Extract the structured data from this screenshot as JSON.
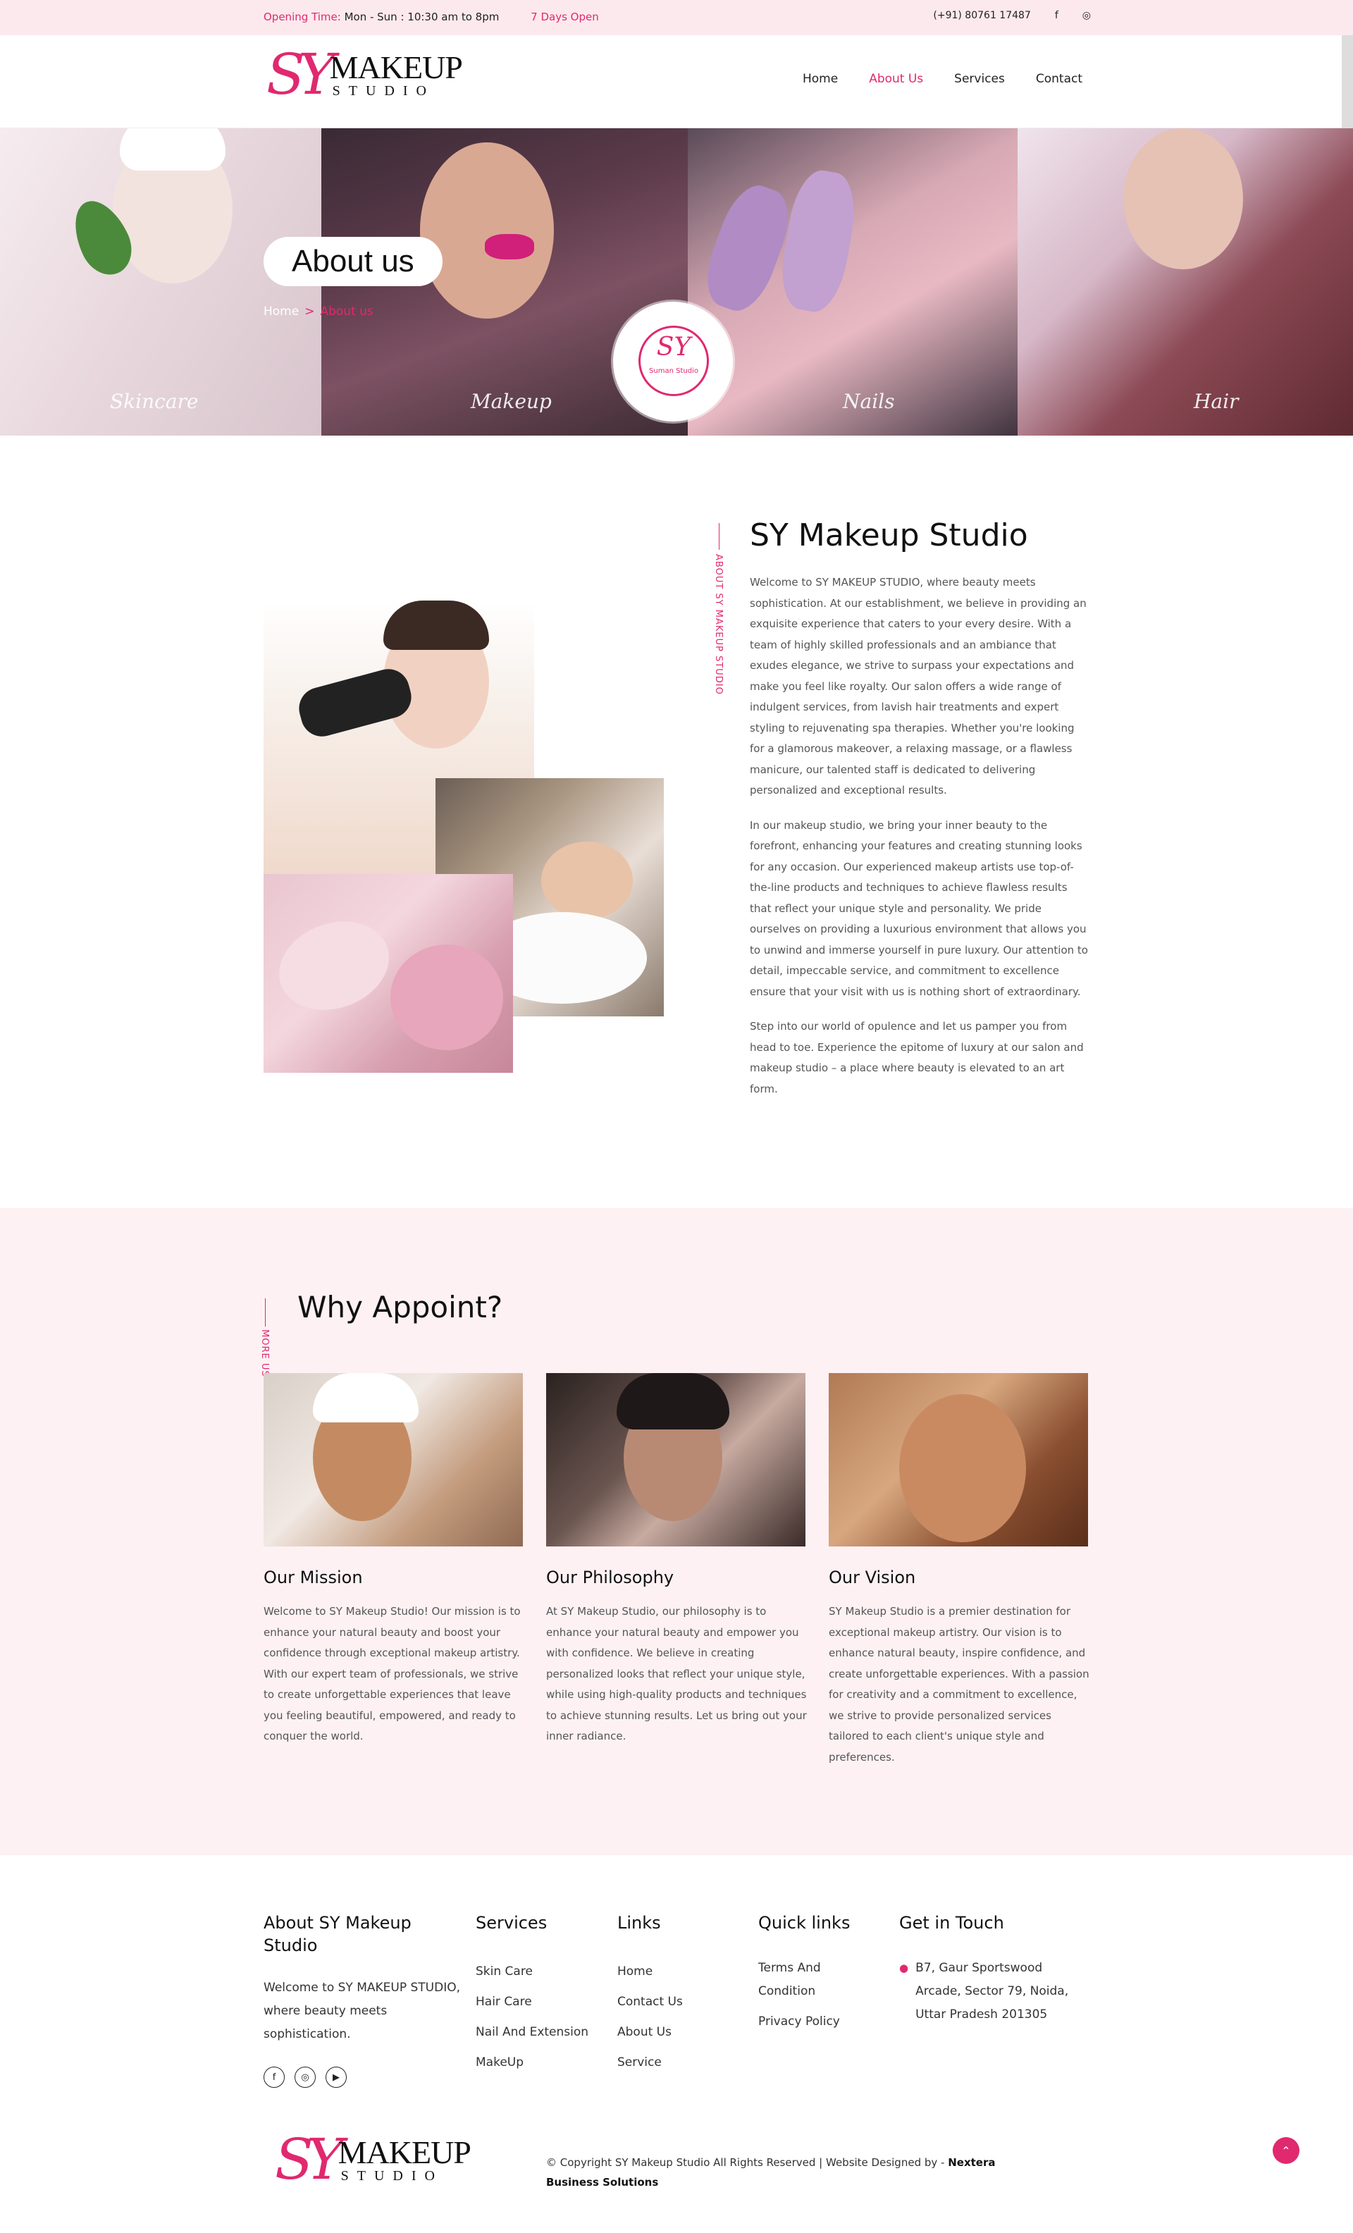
{
  "topbar": {
    "opening_label": "Opening Time:",
    "opening_hours": "Mon - Sun : 10:30 am to 8pm",
    "days_open": "7 Days Open",
    "phone": "(+91) 80761 17487",
    "facebook_icon": "facebook-icon",
    "instagram_icon": "instagram-icon"
  },
  "brand": {
    "monogram": "SY",
    "name_line1": "MAKEUP",
    "name_line2": "STUDIO"
  },
  "nav": {
    "items": [
      "Home",
      "About Us",
      "Services",
      "Contact"
    ],
    "active": "About Us"
  },
  "hero": {
    "title": "About us",
    "breadcrumb_home": "Home",
    "breadcrumb_sep": ">",
    "breadcrumb_current": "About us",
    "panels": [
      "Skincare",
      "Makeup",
      "Nails",
      "Hair"
    ],
    "badge_monogram": "SY",
    "badge_text": "Suman Studio"
  },
  "about": {
    "vertical_label": "ABOUT SY MAKEUP STUDIO",
    "title": "SY Makeup Studio",
    "paragraphs": [
      "Welcome to SY MAKEUP STUDIO, where beauty meets sophistication. At our establishment, we believe in providing an exquisite experience that caters to your every desire. With a team of highly skilled professionals and an ambiance that exudes elegance, we strive to surpass your expectations and make you feel like royalty. Our salon offers a wide range of indulgent services, from lavish hair treatments and expert styling to rejuvenating spa therapies. Whether you're looking for a glamorous makeover, a relaxing massage, or a flawless manicure, our talented staff is dedicated to delivering personalized and exceptional results.",
      "In our makeup studio, we bring your inner beauty to the forefront, enhancing your features and creating stunning looks for any occasion. Our experienced makeup artists use top-of-the-line products and techniques to achieve flawless results that reflect your unique style and personality. We pride ourselves on providing a luxurious environment that allows you to unwind and immerse yourself in pure luxury. Our attention to detail, impeccable service, and commitment to excellence ensure that your visit with us is nothing short of extraordinary.",
      "Step into our world of opulence and let us pamper you from head to toe. Experience the epitome of luxury at our salon and makeup studio – a place where beauty is elevated to an art form."
    ]
  },
  "why": {
    "vertical_label": "MORE US",
    "title": "Why Appoint?",
    "cards": [
      {
        "title": "Our Mission",
        "text": "Welcome to SY Makeup Studio! Our mission is to enhance your natural beauty and boost your confidence through exceptional makeup artistry. With our expert team of professionals, we strive to create unforgettable experiences that leave you feeling beautiful, empowered, and ready to conquer the world."
      },
      {
        "title": "Our Philosophy",
        "text": "At SY Makeup Studio, our philosophy is to enhance your natural beauty and empower you with confidence. We believe in creating personalized looks that reflect your unique style, while using high-quality products and techniques to achieve stunning results. Let us bring out your inner radiance."
      },
      {
        "title": "Our Vision",
        "text": "SY Makeup Studio is a premier destination for exceptional makeup artistry. Our vision is to enhance natural beauty, inspire confidence, and create unforgettable experiences. With a passion for creativity and a commitment to excellence, we strive to provide personalized services tailored to each client's unique style and preferences."
      }
    ]
  },
  "footer": {
    "about_title": "About SY Makeup Studio",
    "about_text": "Welcome to SY MAKEUP STUDIO, where beauty meets sophistication.",
    "services_title": "Services",
    "services": [
      "Skin Care",
      "Hair Care",
      "Nail And Extension",
      "MakeUp"
    ],
    "links_title": "Links",
    "links": [
      "Home",
      "Contact Us",
      "About Us",
      "Service"
    ],
    "quick_title": "Quick links",
    "quick": [
      "Terms And Condition",
      "Privacy Policy"
    ],
    "contact_title": "Get in Touch",
    "address": "B7, Gaur Sportswood Arcade, Sector 79, Noida, Uttar Pradesh 201305",
    "copyright": "© Copyright SY Makeup Studio All Rights Reserved | Website Designed by - ",
    "designer": "Nextera Business Solutions"
  },
  "colors": {
    "accent": "#e0296f",
    "topbar_bg": "#fce9ee",
    "why_bg": "#fdf1f4"
  }
}
